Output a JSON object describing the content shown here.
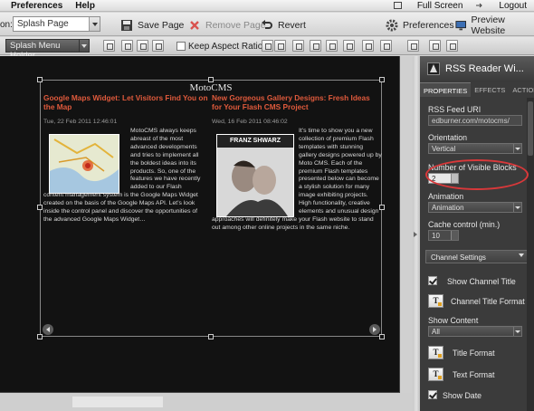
{
  "menubar": {
    "preferences": "Preferences",
    "help": "Help",
    "full_screen": "Full Screen",
    "logout": "Logout"
  },
  "toolbar": {
    "page_label": "on:",
    "page_select": "Splash Page",
    "save_page": "Save Page",
    "remove_page": "Remove Page",
    "revert": "Revert",
    "preferences": "Preferences",
    "preview_website": "Preview Website"
  },
  "toolbar2": {
    "holder_select": "Splash Menu Holder",
    "aspect_ratio": "Keep Aspect Ratio"
  },
  "widget": {
    "title": "MotoCMS",
    "posts": [
      {
        "title": "Google Maps Widget: Let Visitors Find You on the Map",
        "date": "Tue, 22 Feb 2011 12:46:01",
        "body": "MotoCMS always keeps abreast of the most advanced developments and tries to implement all the boldest ideas into its products. So, one of the features we have recently added to our Flash content management system is the Google Maps Widget created on the basis of the Google Maps API. Let’s look inside the control panel and discover the opportunities of the advanced Google Maps Widget…"
      },
      {
        "title": "New Gorgeous Gallery Designs: Fresh Ideas for Your Flash CMS Project",
        "date": "Wed, 16 Feb 2011 08:46:02",
        "thumb_caption": "FRANZ SHWARZ",
        "body": "It’s time to show you a new collection of premium Flash templates with stunning gallery designs powered up by Moto CMS. Each of the premium Flash templates presented below can become a stylish solution for many image exhibiting projects. High functionality, creative elements and unusual design approaches will definitely make your Flash website to stand out among other online projects in the same niche."
      }
    ]
  },
  "panel": {
    "title": "RSS Reader Wi...",
    "tabs": [
      "PROPERTIES",
      "EFFECTS",
      "ACTIONS"
    ],
    "feed_uri_label": "RSS Feed URI",
    "feed_uri_value": "edburner.com/motocms/",
    "orientation_label": "Orientation",
    "orientation_value": "Vertical",
    "visible_blocks_label": "Number of Visible Blocks",
    "visible_blocks_value": "2",
    "animation_label": "Animation",
    "animation_value": "Animation",
    "cache_label": "Cache control (min.)",
    "cache_value": "10",
    "channel_settings": "Channel Settings",
    "show_channel_title": "Show Channel Title",
    "channel_title_format": "Channel Title Format",
    "show_content_label": "Show Content",
    "show_content_value": "All",
    "title_format": "Title Format",
    "text_format": "Text Format",
    "show_date": "Show Date",
    "tt_glyph": "T"
  }
}
